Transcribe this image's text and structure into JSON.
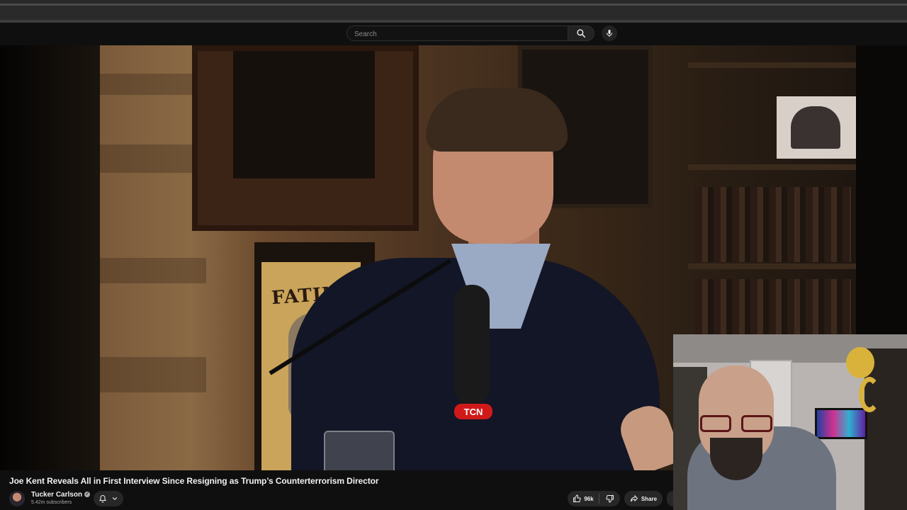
{
  "masthead": {
    "search_placeholder": "Search",
    "search_icon": "search-icon",
    "mic_icon": "microphone-icon"
  },
  "video": {
    "title": "Joe Kent Reveals All in First Interview Since Resigning as Trump’s Counterterrorism Director",
    "scene": {
      "poster_text": "FATIMA",
      "mic_badge_text": "TCN"
    }
  },
  "channel": {
    "name": "Tucker Carlson",
    "verified_icon": "verified-checkmark-icon",
    "subscribers": "5.42m subscribers",
    "bell_icon": "bell-icon",
    "chevron_icon": "chevron-down-icon"
  },
  "actions": {
    "like_count": "96k",
    "like_icon": "thumbs-up-icon",
    "dislike_icon": "thumbs-down-icon",
    "share_label": "Share",
    "share_icon": "share-arrow-icon"
  },
  "colors": {
    "background": "#0f0f0f",
    "button_bg": "#272727",
    "text_primary": "#f1f1f1",
    "text_secondary": "#aaaaaa",
    "mic_badge": "#d01a1a"
  }
}
